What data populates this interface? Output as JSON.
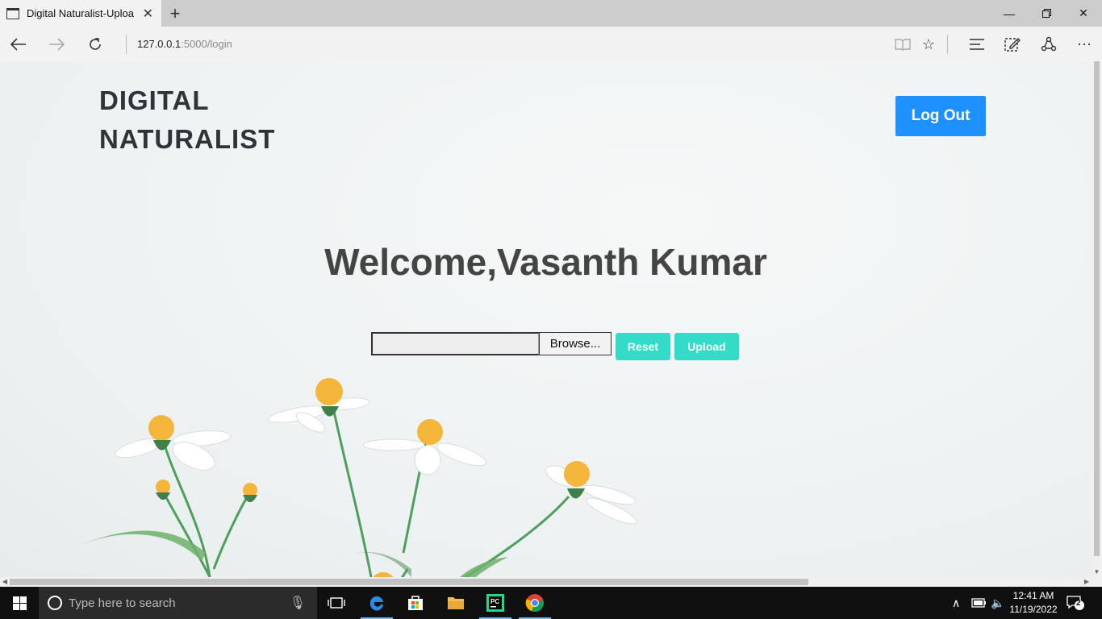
{
  "browser": {
    "tab_title": "Digital Naturalist-Uploa",
    "url_host": "127.0.0.1",
    "url_path": ":5000/login"
  },
  "page": {
    "brand_line1": "DIGITAL",
    "brand_line2": "NATURALIST",
    "logout_label": "Log Out",
    "welcome": "Welcome,Vasanth Kumar",
    "browse_label": "Browse...",
    "reset_label": "Reset",
    "upload_label": "Upload"
  },
  "taskbar": {
    "search_placeholder": "Type here to search",
    "time": "12:41 AM",
    "date": "11/19/2022",
    "notification_count": "2"
  },
  "colors": {
    "logout_bg": "#1e90ff",
    "action_buttons_bg": "#33dcc8"
  }
}
